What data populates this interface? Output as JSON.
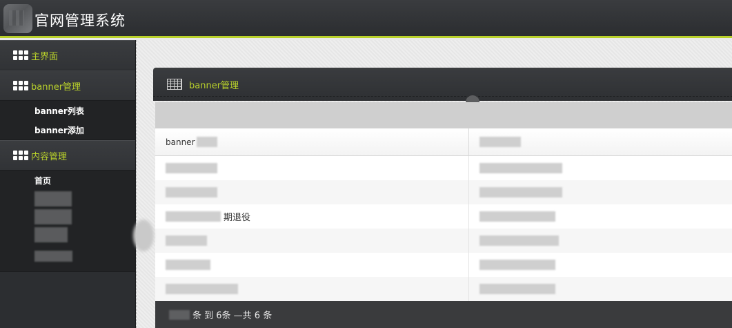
{
  "header": {
    "title": "官网管理系统"
  },
  "sidebar": {
    "sections": [
      {
        "label": "主界面",
        "icon": "grid-icon"
      },
      {
        "label": "banner管理",
        "icon": "grid-icon",
        "items": [
          "banner列表",
          "banner添加"
        ]
      },
      {
        "label": "内容管理",
        "icon": "grid-icon",
        "items": [
          "首页"
        ]
      }
    ]
  },
  "panel": {
    "title": "banner管理",
    "icon": "table-icon",
    "columns": [
      "banner",
      ""
    ],
    "rows": [
      {
        "c1_text": ""
      },
      {
        "c1_text": ""
      },
      {
        "c1_text": "期退役"
      },
      {
        "c1_text": ""
      },
      {
        "c1_text": ""
      },
      {
        "c1_text": ""
      }
    ],
    "footer_text": "条 到 6条 —共 6 条"
  },
  "colors": {
    "accent": "#b9d12b",
    "header_bg": "#2e3033",
    "sidebar_bg": "#2c2e31"
  }
}
